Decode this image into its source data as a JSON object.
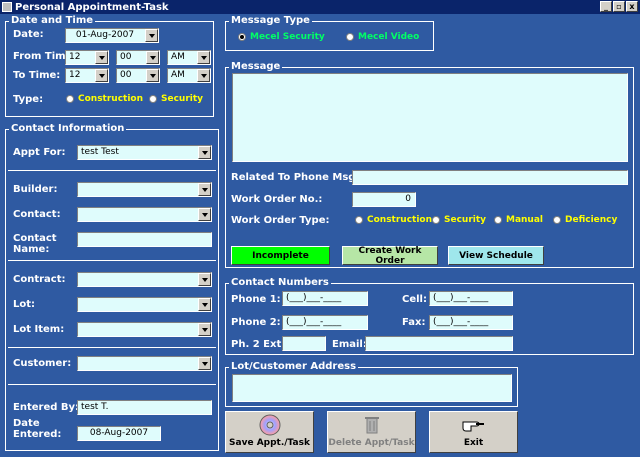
{
  "window": {
    "title": "Personal Appointment-Task",
    "min": "_",
    "max": "▫",
    "close": "x"
  },
  "date_time": {
    "legend": "Date and Time",
    "date_label": "Date:",
    "date_value": "01-Aug-2007",
    "from_label": "From Time:",
    "from_hour": "12",
    "from_min": "00",
    "from_ampm": "AM",
    "to_label": "To Time:",
    "to_hour": "12",
    "to_min": "00",
    "to_ampm": "AM",
    "type_label": "Type:",
    "type_options": [
      "Construction",
      "Security"
    ]
  },
  "contact_info": {
    "legend": "Contact Information",
    "appt_for_label": "Appt For:",
    "appt_for_value": "test Test",
    "builder_label": "Builder:",
    "contact_label": "Contact:",
    "contact_name_label": "Contact\nName:",
    "contract_label": "Contract:",
    "lot_label": "Lot:",
    "lot_item_label": "Lot Item:",
    "customer_label": "Customer:",
    "entered_by_label": "Entered By:",
    "entered_by_value": "test T.",
    "date_entered_label": "Date\nEntered:",
    "date_entered_value": "08-Aug-2007"
  },
  "message_type": {
    "legend": "Message Type",
    "options": [
      "Mecel Security",
      "Mecel Video"
    ]
  },
  "message": {
    "legend": "Message",
    "related_label": "Related To Phone Msg:",
    "work_order_no_label": "Work Order No.:",
    "work_order_no_value": "0",
    "work_order_type_label": "Work Order Type:",
    "work_order_types": [
      "Construction",
      "Security",
      "Manual",
      "Deficiency"
    ]
  },
  "buttons": {
    "incomplete": "Incomplete",
    "create_work_order": "Create Work Order",
    "view_schedule": "View Schedule",
    "save": "Save Appt./Task",
    "delete": "Delete Appt/Task",
    "exit": "Exit"
  },
  "contact_numbers": {
    "legend": "Contact Numbers",
    "phone1_label": "Phone 1:",
    "phone2_label": "Phone 2:",
    "cell_label": "Cell:",
    "fax_label": "Fax:",
    "mask": "(___)___-____",
    "ph2ext_label": "Ph. 2 Ext:",
    "email_label": "Email:"
  },
  "address": {
    "legend": "Lot/Customer Address"
  },
  "colors": {
    "background": "#2f5aa2",
    "field": "#dffcfc",
    "incomplete": "#00ff00",
    "create": "#b6e6a6",
    "view": "#9fe7ec",
    "radio_text": "#ffff00",
    "message_type_text": "#00ff66"
  }
}
